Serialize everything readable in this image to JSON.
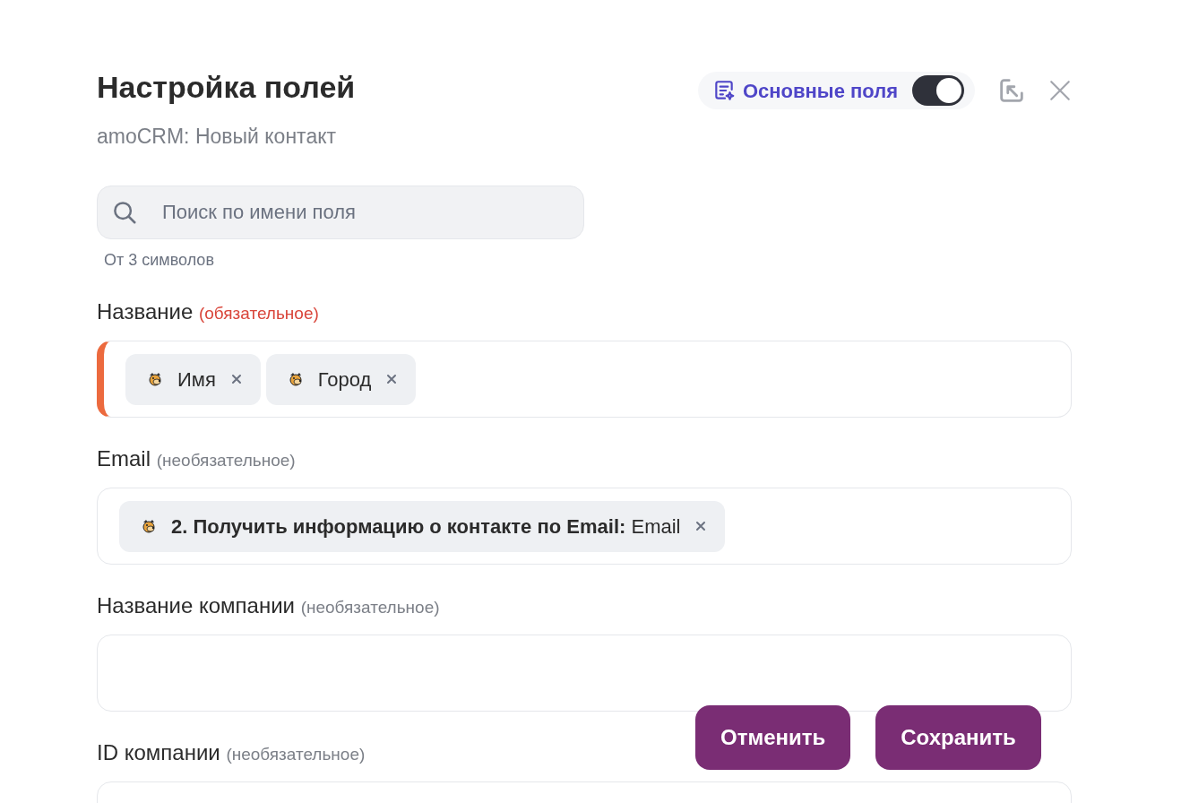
{
  "header": {
    "title": "Настройка полей",
    "subtitle": "amoCRM: Новый контакт"
  },
  "basic_fields_toggle": {
    "label": "Основные поля",
    "on": true
  },
  "search": {
    "placeholder": "Поиск по имени поля",
    "hint": "От 3 символов"
  },
  "fields": [
    {
      "label": "Название",
      "requirement": "(обязательное)",
      "required": true,
      "chips": [
        {
          "kind": "plain",
          "text": "Имя"
        },
        {
          "kind": "plain",
          "text": "Город"
        }
      ]
    },
    {
      "label": "Email",
      "requirement": "(необязательное)",
      "required": false,
      "chips": [
        {
          "kind": "step",
          "step": "2. Получить информацию о контакте по Email:",
          "text": "Email"
        }
      ]
    },
    {
      "label": "Название компании",
      "requirement": "(необязательное)",
      "required": false
    },
    {
      "label": "ID компании",
      "requirement": "(необязательное)",
      "required": false
    }
  ],
  "buttons": [
    "Отменить",
    "Сохранить"
  ]
}
